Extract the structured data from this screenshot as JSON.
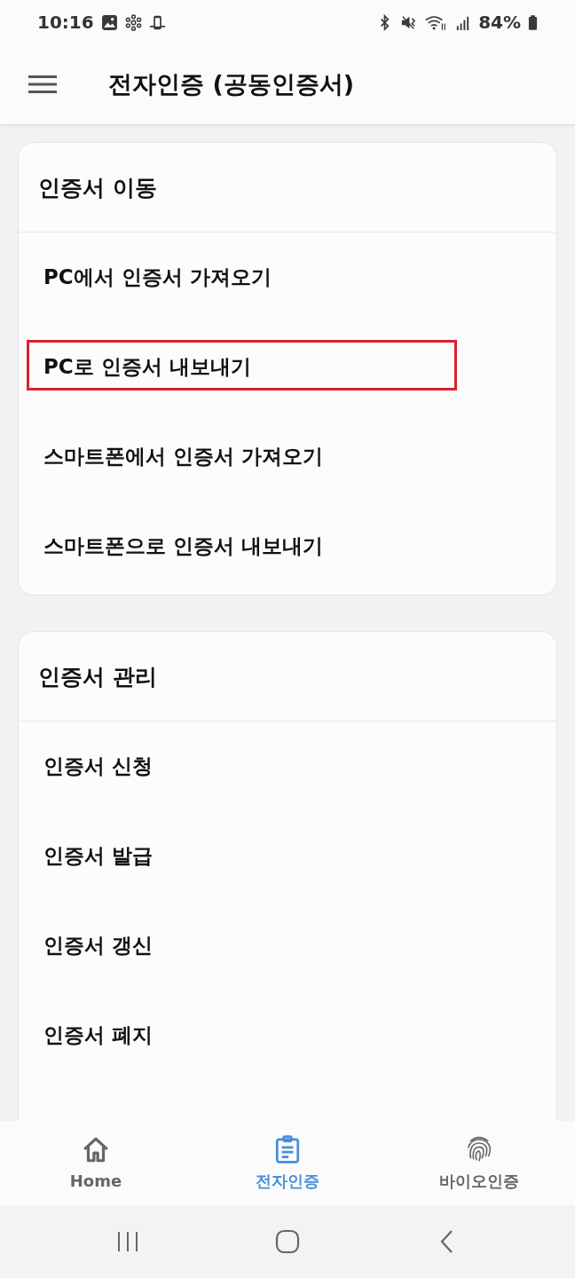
{
  "status_bar": {
    "time": "10:16",
    "battery": "84%"
  },
  "app_bar": {
    "title": "전자인증 (공동인증서)"
  },
  "sections": [
    {
      "title": "인증서 이동",
      "items": [
        {
          "label": "PC에서 인증서 가져오기",
          "highlighted": false
        },
        {
          "label": "PC로 인증서 내보내기",
          "highlighted": true
        },
        {
          "label": "스마트폰에서 인증서 가져오기",
          "highlighted": false
        },
        {
          "label": "스마트폰으로 인증서 내보내기",
          "highlighted": false
        }
      ]
    },
    {
      "title": "인증서 관리",
      "items": [
        {
          "label": "인증서 신청",
          "highlighted": false
        },
        {
          "label": "인증서 발급",
          "highlighted": false
        },
        {
          "label": "인증서 갱신",
          "highlighted": false
        },
        {
          "label": "인증서 폐지",
          "highlighted": false
        }
      ]
    }
  ],
  "bottom_nav": [
    {
      "label": "Home",
      "selected": false
    },
    {
      "label": "전자인증",
      "selected": true
    },
    {
      "label": "바이오인증",
      "selected": false
    }
  ]
}
